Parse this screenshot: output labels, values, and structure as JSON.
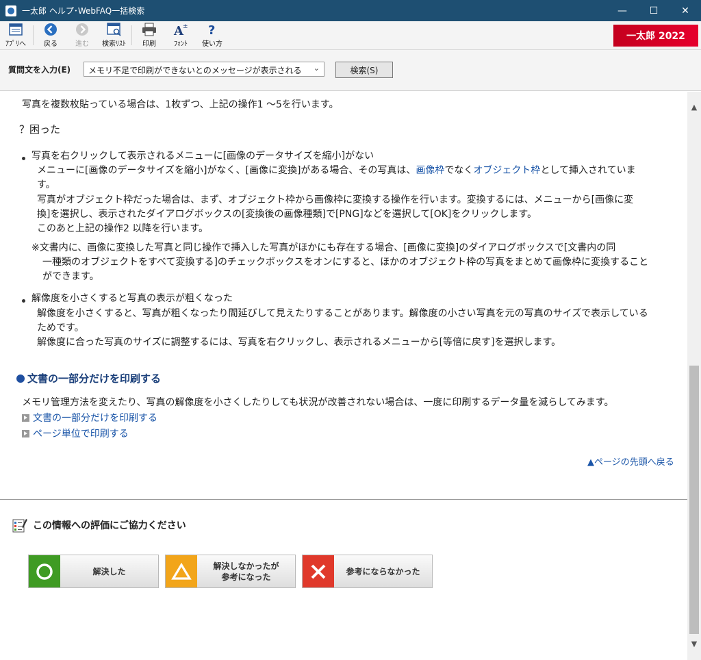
{
  "window": {
    "title": "一太郎 ヘルプ･WebFAQ一括検索",
    "minimize": "—",
    "maximize": "☐",
    "close": "✕"
  },
  "toolbar": {
    "apps": "ｱﾌﾟﾘへ",
    "back": "戻る",
    "forward": "進む",
    "search_list": "検索ﾘｽﾄ",
    "print": "印刷",
    "font": "ﾌｫﾝﾄ",
    "usage": "使い方",
    "brand": "一太郎 2022"
  },
  "search": {
    "label": "質問文を入力(E)",
    "value": "メモリ不足で印刷ができないとのメッセージが表示される",
    "button": "検索(S)"
  },
  "content": {
    "intro": "写真を複数枚貼っている場合は、1枚ずつ、上記の操作1 ～5を行います。",
    "trouble_heading": "？困った",
    "item1_title": "写真を右クリックして表示されるメニューに[画像のデータサイズを縮小]がない",
    "item1_line1_a": "メニューに[画像のデータサイズを縮小]がなく、[画像に変換]がある場合、その写真は、",
    "item1_link1": "画像枠",
    "item1_line1_b": "でなく",
    "item1_link2": "オブジェクト枠",
    "item1_line1_c": "として挿入されていま",
    "item1_line2": "す。",
    "item1_line3": "写真がオブジェクト枠だった場合は、まず、オブジェクト枠から画像枠に変換する操作を行います。変換するには、メニューから[画像に変",
    "item1_line4": "換]を選択し、表示されたダイアログボックスの[変換後の画像種類]で[PNG]などを選択して[OK]をクリックします。",
    "item1_line5": "このあと上記の操作2 以降を行います。",
    "note_line1": "※文書内に、画像に変換した写真と同じ操作で挿入した写真がほかにも存在する場合、[画像に変換]のダイアログボックスで[文書内の同",
    "note_line2": "一種類のオブジェクトをすべて変換する]のチェックボックスをオンにすると、ほかのオブジェクト枠の写真をまとめて画像枠に変換すること",
    "note_line3": "ができます。",
    "item2_title": "解像度を小さくすると写真の表示が粗くなった",
    "item2_line1": "解像度を小さくすると、写真が粗くなったり間延びして見えたりすることがあります。解像度の小さい写真を元の写真のサイズで表示している",
    "item2_line2": "ためです。",
    "item2_line3": "解像度に合った写真のサイズに調整するには、写真を右クリックし、表示されるメニューから[等倍に戻す]を選択します。",
    "section_title": "文書の一部分だけを印刷する",
    "section_desc": "メモリ管理方法を変えたり、写真の解像度を小さくしたりしても状況が改善されない場合は、一度に印刷するデータ量を減らしてみます。",
    "link_partial": "文書の一部分だけを印刷する",
    "link_page": "ページ単位で印刷する",
    "page_top": "▲ページの先頭へ戻る"
  },
  "rating": {
    "title": "この情報への評価にご協力ください",
    "resolved": "解決した",
    "partial_line1": "解決しなかったが",
    "partial_line2": "参考になった",
    "not_helpful": "参考にならなかった",
    "colors": {
      "green": "#3f9b23",
      "orange": "#f2a51a",
      "red": "#e0392b"
    }
  }
}
